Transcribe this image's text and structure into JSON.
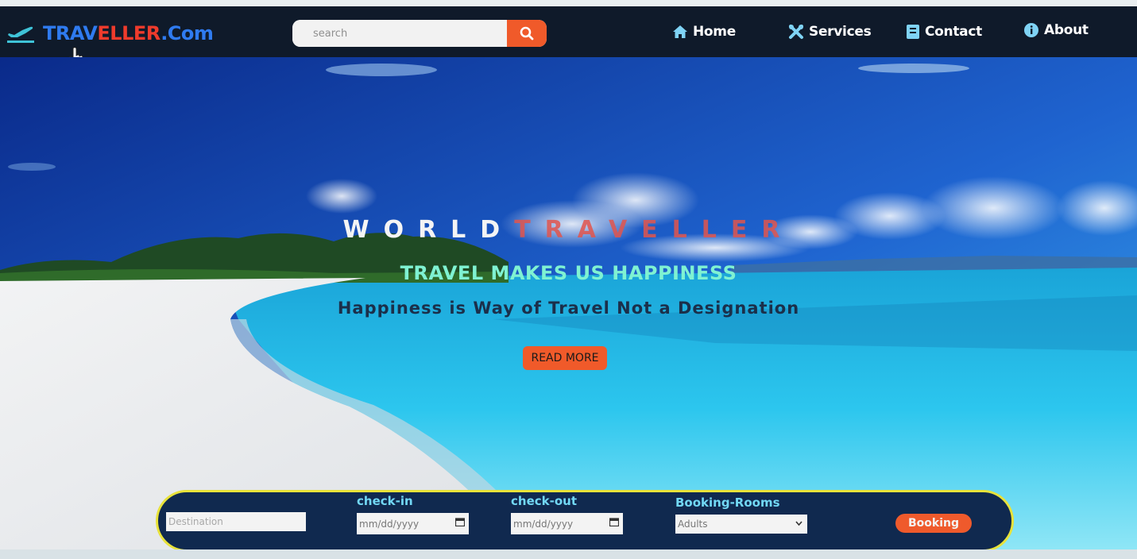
{
  "brand": {
    "part1": "TRAV",
    "part2": "ELLER",
    "part3": ".Com"
  },
  "search": {
    "placeholder": "search"
  },
  "nav": [
    {
      "label": "Home",
      "icon": "home-icon"
    },
    {
      "label": "Services",
      "icon": "tools-icon"
    },
    {
      "label": "Contact",
      "icon": "contact-book-icon"
    },
    {
      "label": "About",
      "icon": "info-icon"
    }
  ],
  "hero": {
    "title_word1": "WORLD",
    "title_word2": "TRAVELLER",
    "tagline": "TRAVEL MAKES US HAPPINESS",
    "subtitle": "Happiness is Way of Travel Not a Designation",
    "read_more": "READ MORE"
  },
  "booking": {
    "destination_placeholder": "Destination",
    "checkin_label": "check-in",
    "checkin_value": "mm/dd/yyyy",
    "checkout_label": "check-out",
    "checkout_value": "mm/dd/yyyy",
    "rooms_label": "Booking-Rooms",
    "rooms_selected": "Adults",
    "button": "Booking"
  },
  "colors": {
    "navbar": "#0f1a2a",
    "brand_blue": "#2f7bf0",
    "brand_red": "#ef3b2c",
    "accent_orange": "#f05a2a",
    "tagline": "#7ff2d2",
    "booking_bg": "#10294f",
    "booking_border": "#e8e23a",
    "booking_label": "#72d8f5"
  }
}
